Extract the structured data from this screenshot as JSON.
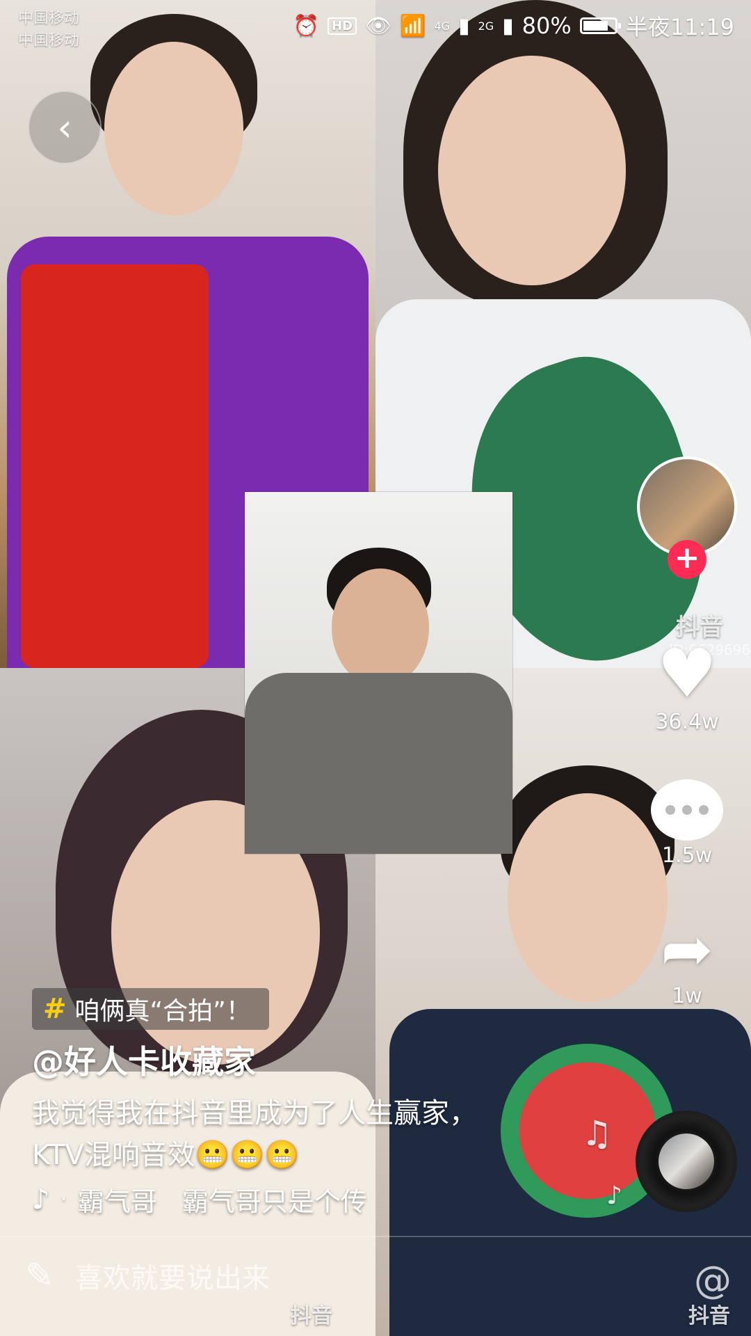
{
  "status_bar": {
    "carrier_1": "中国移动",
    "carrier_2": "中国移动",
    "hd": "HD",
    "net_4g": "4G",
    "net_2g": "2G",
    "battery": "80%",
    "battery_level": 0.8,
    "time": "半夜11:19"
  },
  "side_actions": {
    "likes": "36.4w",
    "comments": "1.5w",
    "shares": "1w"
  },
  "watermark": {
    "logo": "抖音",
    "id": "ID:6629696"
  },
  "post": {
    "hashtag": "咱俩真“合拍”！",
    "author": "@好人卡收藏家",
    "caption_line1": "我觉得我在抖音里成为了人生赢家，",
    "caption_line2": "KTV混响音效😬😬😬",
    "music_artist": "霸气哥",
    "music_title": "霸气哥只是个传"
  },
  "comment_bar": {
    "placeholder": "喜欢就要说出来"
  },
  "icons": [
    "back-icon",
    "heart-icon",
    "comment-icon",
    "share-icon",
    "music-note-icon",
    "edit-icon",
    "at-icon",
    "follow-plus-icon"
  ],
  "colors": {
    "accent": "#fe2c55",
    "hashtag": "#face15"
  }
}
